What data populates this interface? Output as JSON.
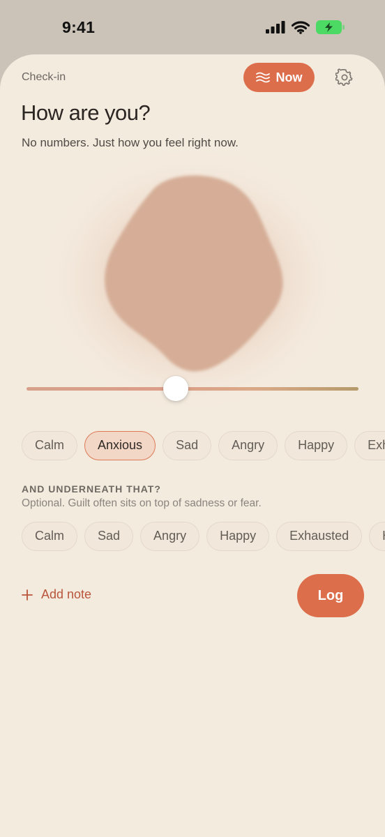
{
  "status_bar": {
    "time": "9:41",
    "icons": [
      "cellular-signal-icon",
      "wifi-icon",
      "battery-charging-icon"
    ],
    "battery_color": "#4cd964"
  },
  "header": {
    "label": "Check-in",
    "now_button": {
      "icon": "waves-icon",
      "label": "Now"
    },
    "settings_icon": "gear-icon"
  },
  "main": {
    "title": "How are you?",
    "subtitle": "No numbers. Just how you feel right now."
  },
  "mood_visual": {
    "shape": "soft-pentagon-blob",
    "color": "#d6ae97",
    "glow_color": "#e4c3ad"
  },
  "mood_slider": {
    "value": 0.45
  },
  "primary_emotions": [
    {
      "label": "Calm",
      "selected": false
    },
    {
      "label": "Anxious",
      "selected": true
    },
    {
      "label": "Sad",
      "selected": false
    },
    {
      "label": "Angry",
      "selected": false
    },
    {
      "label": "Happy",
      "selected": false
    },
    {
      "label": "Exhausted",
      "selected": false
    }
  ],
  "underneath": {
    "label": "AND UNDERNEATH THAT?",
    "hint": "Optional. Guilt often sits on top of sadness or fear.",
    "emotions": [
      {
        "label": "Calm"
      },
      {
        "label": "Sad"
      },
      {
        "label": "Angry"
      },
      {
        "label": "Happy"
      },
      {
        "label": "Exhausted"
      },
      {
        "label": "Hopeful"
      }
    ]
  },
  "actions": {
    "add_note": {
      "icon": "plus-icon",
      "label": "Add note"
    },
    "log_label": "Log"
  },
  "colors": {
    "accent": "#dd6e4b",
    "background": "#f4ebdf",
    "selected_chip_bg": "#f2d7c6",
    "selected_chip_border": "#dc7a57",
    "add_note_text": "#b9553b"
  }
}
